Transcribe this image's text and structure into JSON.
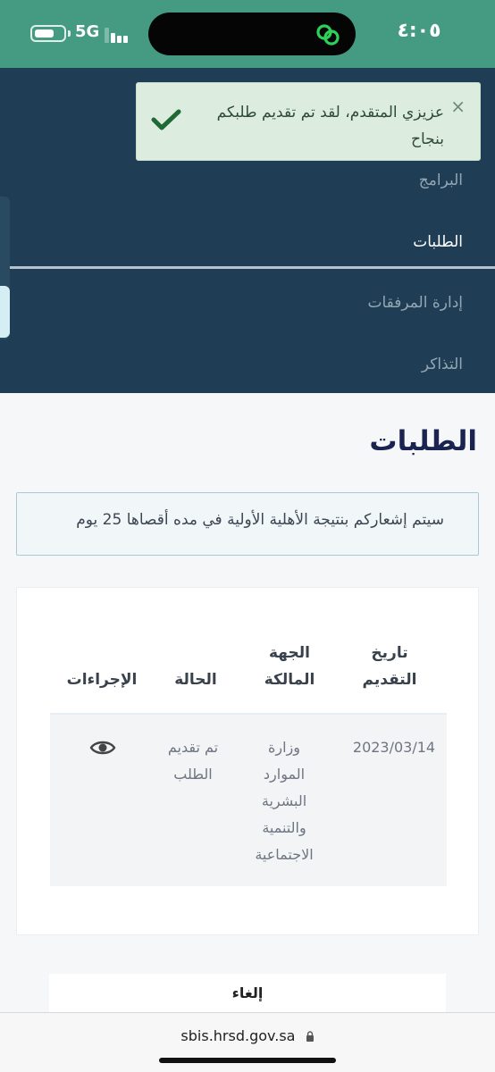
{
  "status_bar": {
    "network": "5G",
    "time": "٤:٠٥",
    "battery_level": 0.7,
    "signal_bars_active": 2
  },
  "toast": {
    "message": "عزيزي المتقدم، لقد تم تقديم طلبكم بنجاح",
    "close_symbol": "×",
    "check_color": "#1f6a34"
  },
  "nav": {
    "items": [
      {
        "label": "البرامج"
      },
      {
        "label": "الطلبات"
      },
      {
        "label": "إدارة المرفقات"
      },
      {
        "label": "التذاكر"
      }
    ],
    "active_index": 1
  },
  "page": {
    "title": "الطلبات",
    "notice": "سيتم إشعاركم بنتيجة الأهلية الأولية في مده أقصاها 25 يوم"
  },
  "table": {
    "headers": {
      "date": "تاريخ التقديم",
      "owner": "الجهة المالكة",
      "status": "الحالة",
      "actions": "الإجراءات"
    },
    "rows": [
      {
        "date": "2023/03/14",
        "owner": "وزارة الموارد البشرية والتنمية الاجتماعية",
        "status": "تم تقديم الطلب",
        "action_icon": "eye-icon"
      }
    ]
  },
  "footer": {
    "cancel_label": "إلغاء"
  },
  "browser": {
    "url": "sbis.hrsd.gov.sa"
  },
  "colors": {
    "status_bar": "#459b81",
    "nav_background": "#1f3d54",
    "title": "#1b2350",
    "toast_background": "#dcecdf"
  }
}
